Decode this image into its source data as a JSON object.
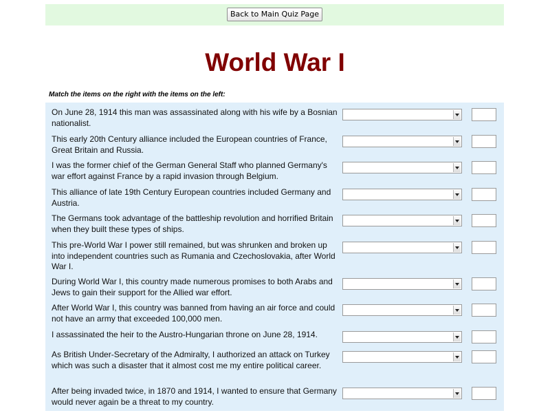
{
  "topbar": {
    "back_button_label": "Back to Main Quiz Page"
  },
  "page_title": "World War I",
  "instruction": "Match the items on the right with the items on the left:",
  "questions": [
    {
      "text": "On June 28, 1914 this man was assassinated along with his wife by a Bosnian nationalist.",
      "selected": "",
      "answer": ""
    },
    {
      "text": "This early 20th Century alliance included the European countries of France, Great Britain and Russia.",
      "selected": "",
      "answer": ""
    },
    {
      "text": "I was the former chief of the German General Staff who planned Germany's war effort against France by a rapid invasion through Belgium.",
      "selected": "",
      "answer": ""
    },
    {
      "text": "This alliance of late 19th Century European countries included Germany and Austria.",
      "selected": "",
      "answer": ""
    },
    {
      "text": "The Germans took advantage of the battleship revolution and horrified Britain when they built these types of ships.",
      "selected": "",
      "answer": ""
    },
    {
      "text": "This pre-World War I power still remained, but was shrunken and broken up into independent countries such as Rumania and Czechoslovakia, after World War I.",
      "selected": "",
      "answer": ""
    },
    {
      "text": "During World War I, this country made numerous promises to both Arabs and Jews to gain their support for the Allied war effort.",
      "selected": "",
      "answer": ""
    },
    {
      "text": "After World War I, this country was banned from having an air force and could not have an army that exceeded 100,000 men.",
      "selected": "",
      "answer": ""
    },
    {
      "text": "I assassinated the heir to the Austro-Hungarian throne on June 28, 1914.",
      "selected": "",
      "answer": ""
    },
    {
      "text": "As British Under-Secretary of the Admiralty, I authorized an attack on Turkey which was such a disaster that it almost cost me my entire political career.",
      "selected": "",
      "answer": ""
    },
    {
      "text": "After being invaded twice, in 1870 and 1914, I wanted to ensure that Germany would never again be a threat to my country.",
      "selected": "",
      "answer": ""
    }
  ],
  "colors": {
    "topbar_bg": "#e2f9e0",
    "title": "#800000",
    "quiz_bg": "#e0effa"
  }
}
